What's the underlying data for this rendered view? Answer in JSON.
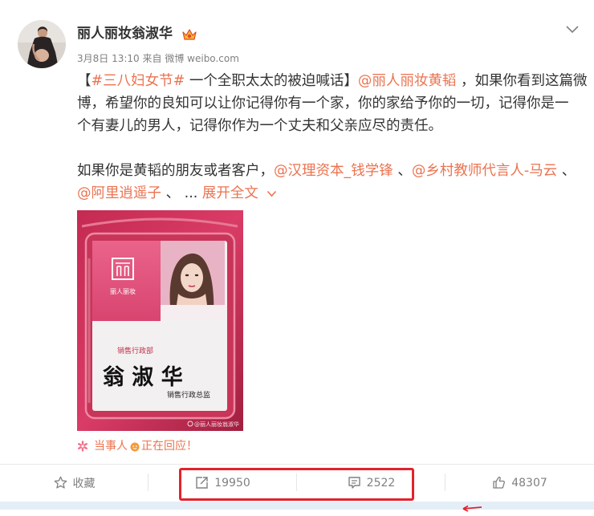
{
  "theme": {
    "link_color": "#eb7350",
    "text_color": "#333333",
    "muted_color": "#808080",
    "highlight_color": "#e3222c"
  },
  "post": {
    "author": {
      "name": "丽人丽妆翁淑华",
      "badge_icon": "crown-badge-icon"
    },
    "menu_icon": "chevron-down-icon",
    "meta": {
      "date": "3月8日 13:10",
      "from_label": "来自",
      "source": "微博 weibo.com"
    },
    "text_lines": [
      [
        "【",
        "#三八妇女节#",
        " 一个全职太太的被迫喊话】",
        "@丽人丽妆黄韬",
        " ，如果你看到这篇微"
      ],
      [
        "博，希望你的良知可以让你记得你有一个家，你的家给予你的一切，记得你是一"
      ],
      [
        "个有妻儿的男人，记得你作为一个丈夫和父亲应尽的责任。"
      ],
      [],
      [
        "如果你是黄韬的朋友或者客户，",
        "@汉理资本_钱学锋",
        " 、",
        "@乡村教师代言人-马云",
        " 、"
      ],
      [
        "@阿里逍遥子",
        " 、 ... "
      ]
    ],
    "expand_label": "展开全文",
    "image": {
      "logo_text": "丽人丽妆",
      "department": "销售行政部",
      "name": "翁 淑 华",
      "title": "销售行政总监",
      "watermark": "@丽人丽妆翁淑华"
    },
    "response_notice": {
      "prefix": "当事人",
      "suffix": "正在回应！"
    }
  },
  "actions": [
    {
      "icon": "star-icon",
      "label": "收藏"
    },
    {
      "icon": "share-icon",
      "label": "19950"
    },
    {
      "icon": "comment-icon",
      "label": "2522"
    },
    {
      "icon": "like-icon",
      "label": "48307"
    }
  ]
}
